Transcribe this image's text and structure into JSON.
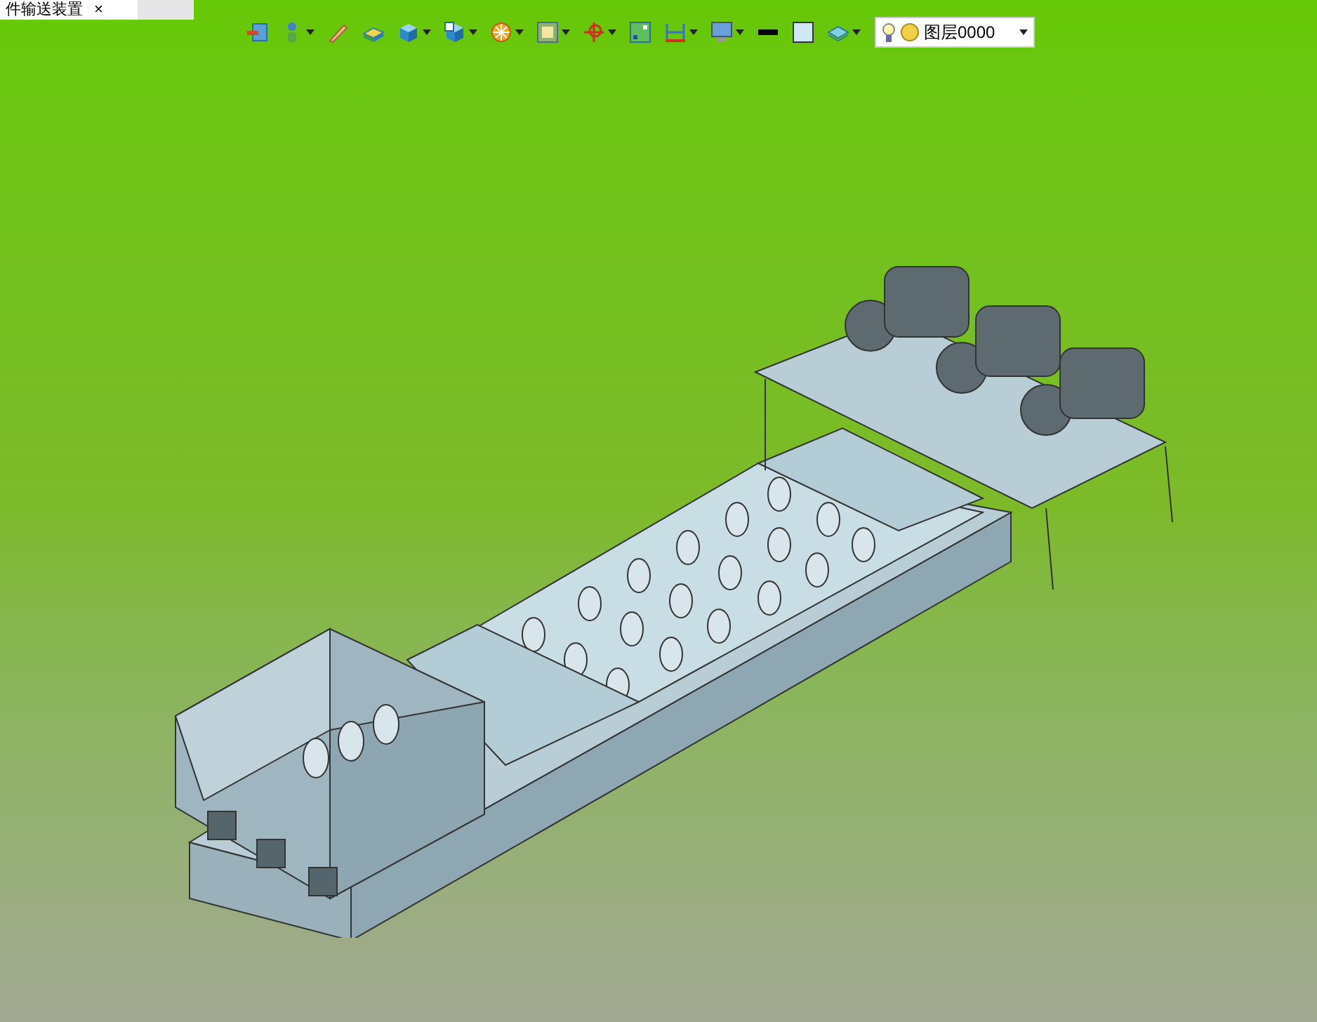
{
  "document_tab": {
    "title": "件输送装置",
    "close": "×",
    "selected": true
  },
  "toolbar": [
    {
      "kind": "exit",
      "dropdown": false
    },
    {
      "kind": "person",
      "dropdown": true
    },
    {
      "kind": "pencil",
      "dropdown": false
    },
    {
      "kind": "slab",
      "dropdown": false
    },
    {
      "kind": "cube",
      "dropdown": true
    },
    {
      "kind": "cubeview",
      "dropdown": true
    },
    {
      "kind": "wheel",
      "dropdown": true
    },
    {
      "kind": "frame",
      "dropdown": true
    },
    {
      "kind": "crosshair",
      "dropdown": true
    },
    {
      "kind": "grid",
      "dropdown": false
    },
    {
      "kind": "dimension",
      "dropdown": true
    },
    {
      "kind": "monitor",
      "dropdown": true
    },
    {
      "kind": "lineweight",
      "dropdown": false
    },
    {
      "kind": "swatch",
      "dropdown": false
    },
    {
      "kind": "layers",
      "dropdown": true
    }
  ],
  "layer_selector": {
    "value": "图层0000"
  }
}
